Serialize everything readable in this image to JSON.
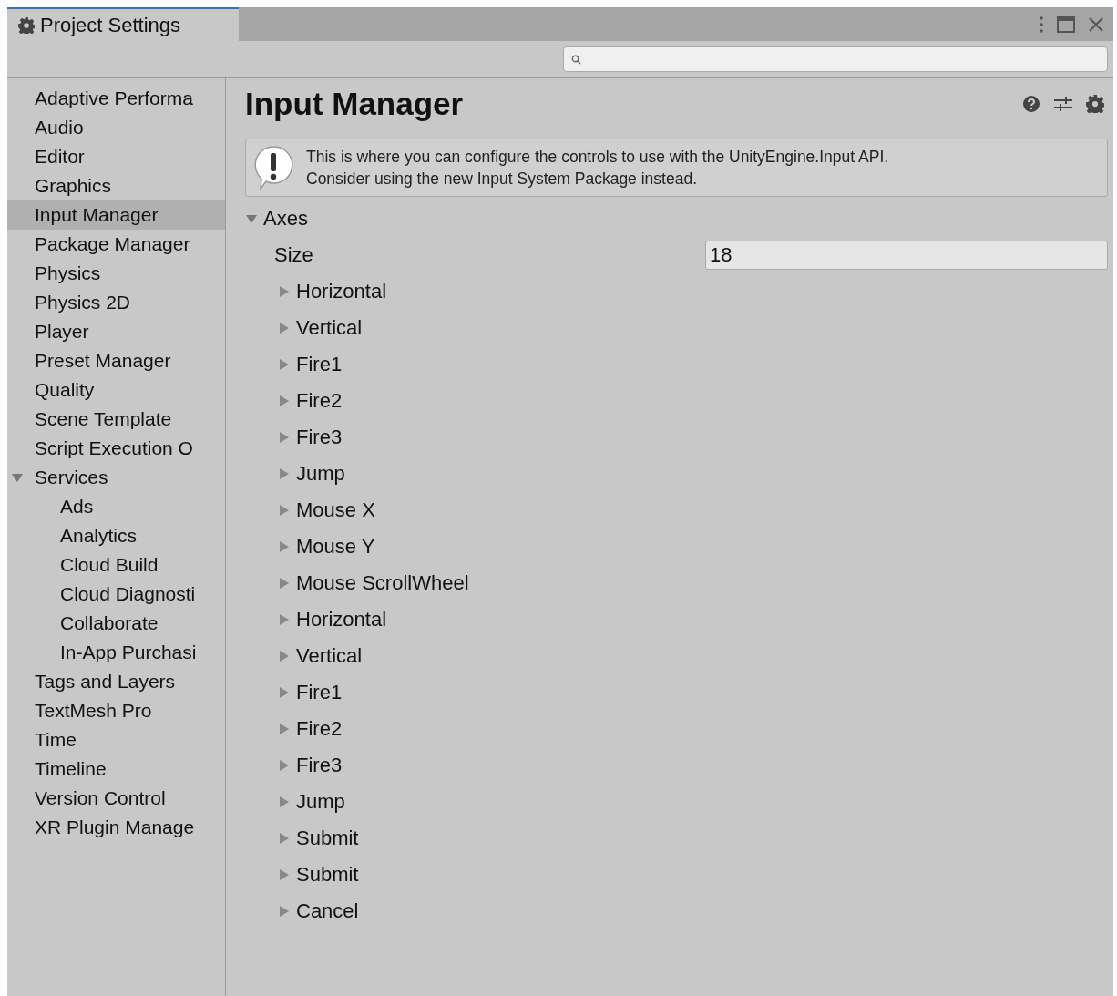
{
  "window": {
    "title": "Project Settings"
  },
  "sidebar": {
    "items": [
      {
        "label": "Adaptive Performa",
        "selected": false
      },
      {
        "label": "Audio",
        "selected": false
      },
      {
        "label": "Editor",
        "selected": false
      },
      {
        "label": "Graphics",
        "selected": false
      },
      {
        "label": "Input Manager",
        "selected": true
      },
      {
        "label": "Package Manager",
        "selected": false
      },
      {
        "label": "Physics",
        "selected": false
      },
      {
        "label": "Physics 2D",
        "selected": false
      },
      {
        "label": "Player",
        "selected": false
      },
      {
        "label": "Preset Manager",
        "selected": false
      },
      {
        "label": "Quality",
        "selected": false
      },
      {
        "label": "Scene Template",
        "selected": false
      },
      {
        "label": "Script Execution O",
        "selected": false
      },
      {
        "label": "Services",
        "selected": false,
        "expanded": true,
        "children": [
          {
            "label": "Ads",
            "selected": false
          },
          {
            "label": "Analytics",
            "selected": false
          },
          {
            "label": "Cloud Build",
            "selected": false
          },
          {
            "label": "Cloud Diagnosti",
            "selected": false
          },
          {
            "label": "Collaborate",
            "selected": false
          },
          {
            "label": "In-App Purchasi",
            "selected": false
          }
        ]
      },
      {
        "label": "Tags and Layers",
        "selected": false
      },
      {
        "label": "TextMesh Pro",
        "selected": false
      },
      {
        "label": "Time",
        "selected": false
      },
      {
        "label": "Timeline",
        "selected": false
      },
      {
        "label": "Version Control",
        "selected": false
      },
      {
        "label": "XR Plugin Manage",
        "selected": false
      }
    ]
  },
  "content": {
    "title": "Input Manager",
    "message": "This is where you can configure the controls to use with the UnityEngine.Input API.\nConsider using the new Input System Package instead.",
    "axes": {
      "label": "Axes",
      "expanded": true,
      "size_label": "Size",
      "size_value": "18",
      "items": [
        {
          "label": "Horizontal",
          "expanded": false
        },
        {
          "label": "Vertical",
          "expanded": false
        },
        {
          "label": "Fire1",
          "expanded": false
        },
        {
          "label": "Fire2",
          "expanded": false
        },
        {
          "label": "Fire3",
          "expanded": false
        },
        {
          "label": "Jump",
          "expanded": false
        },
        {
          "label": "Mouse X",
          "expanded": false
        },
        {
          "label": "Mouse Y",
          "expanded": false
        },
        {
          "label": "Mouse ScrollWheel",
          "expanded": false
        },
        {
          "label": "Horizontal",
          "expanded": false
        },
        {
          "label": "Vertical",
          "expanded": false
        },
        {
          "label": "Fire1",
          "expanded": false
        },
        {
          "label": "Fire2",
          "expanded": false
        },
        {
          "label": "Fire3",
          "expanded": false
        },
        {
          "label": "Jump",
          "expanded": false
        },
        {
          "label": "Submit",
          "expanded": false
        },
        {
          "label": "Submit",
          "expanded": false
        },
        {
          "label": "Cancel",
          "expanded": false
        }
      ]
    }
  }
}
